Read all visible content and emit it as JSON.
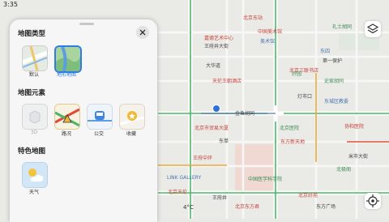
{
  "status_bar": {
    "time": "3:35"
  },
  "panel": {
    "sections": {
      "map_type": "地图类型",
      "map_elements": "地图元素",
      "featured": "特色地图"
    },
    "map_types": [
      {
        "label": "默认",
        "icon": "default-map-icon",
        "selected": false
      },
      {
        "label": "地形地图",
        "icon": "terrain-map-icon",
        "selected": true
      }
    ],
    "elements": [
      {
        "label": "3D",
        "icon": "3d-building-icon",
        "enabled": false
      },
      {
        "label": "路况",
        "icon": "traffic-icon",
        "enabled": true
      },
      {
        "label": "公交",
        "icon": "bus-icon",
        "enabled": true
      },
      {
        "label": "收藏",
        "icon": "favorite-star-icon",
        "enabled": true
      }
    ],
    "featured": [
      {
        "label": "天气",
        "icon": "weather-icon"
      }
    ]
  },
  "map": {
    "labels": {
      "l1": "北京东站",
      "l2": "嘉德艺术中心",
      "l3": "王府井大街",
      "l4": "大华道",
      "l5": "美术馆",
      "l6": "北京三联书店",
      "l7": "中国美术馆",
      "l8": "东四",
      "l9": "礼士胡同",
      "l10": "第一保护",
      "l11": "天伦王朝酒店",
      "l12": "好园",
      "l13": "史家胡同",
      "l14": "灯市口",
      "l15": "东城区教委",
      "l16": "金鱼胡同",
      "l17": "北京市贸易大厦",
      "l18": "东单",
      "l19": "王府中环",
      "l20": "北京医院",
      "l21": "LINK GALLERY",
      "l22": "中国医学科学院",
      "l23": "北京天伦",
      "l24": "王府井",
      "l25": "北京东方君",
      "l26": "东方新天地",
      "l27": "北京好苑",
      "l28": "协和医院",
      "l29": "米市大街",
      "l30": "东方广场",
      "l31": "北极阁"
    },
    "temperature": "4°C"
  },
  "buttons": {
    "layers": "layers-icon",
    "locate": "locate-icon"
  }
}
